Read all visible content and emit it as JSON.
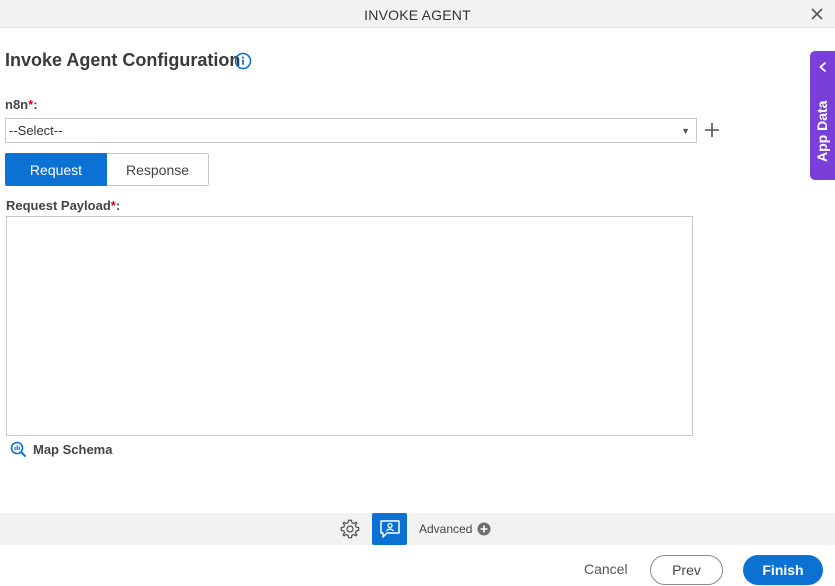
{
  "window": {
    "title": "INVOKE AGENT",
    "close_icon": "close-icon"
  },
  "heading": {
    "title": "Invoke Agent Configuration",
    "info_icon": "info-icon"
  },
  "n8n_field": {
    "label": "n8n",
    "required_mark": "*",
    "colon": ":",
    "selected": "--Select--",
    "add_icon": "plus-icon"
  },
  "tabs": [
    {
      "label": "Request",
      "active": true
    },
    {
      "label": "Response",
      "active": false
    }
  ],
  "payload_field": {
    "label": "Request Payload",
    "required_mark": "*",
    "colon": ":",
    "value": ""
  },
  "map_schema": {
    "label": "Map Schema",
    "icon": "map-schema-icon"
  },
  "side_panel": {
    "label": "App Data",
    "icon": "chevron-left-icon"
  },
  "toolbar": {
    "settings_icon": "gear-icon",
    "chat_icon": "chat-user-icon",
    "advanced_label": "Advanced",
    "advanced_icon": "plus-circle-icon"
  },
  "footer": {
    "cancel_label": "Cancel",
    "prev_label": "Prev",
    "finish_label": "Finish"
  },
  "colors": {
    "primary": "#0b71d3",
    "side_panel": "#7b3fd9",
    "required": "#d0021b"
  }
}
